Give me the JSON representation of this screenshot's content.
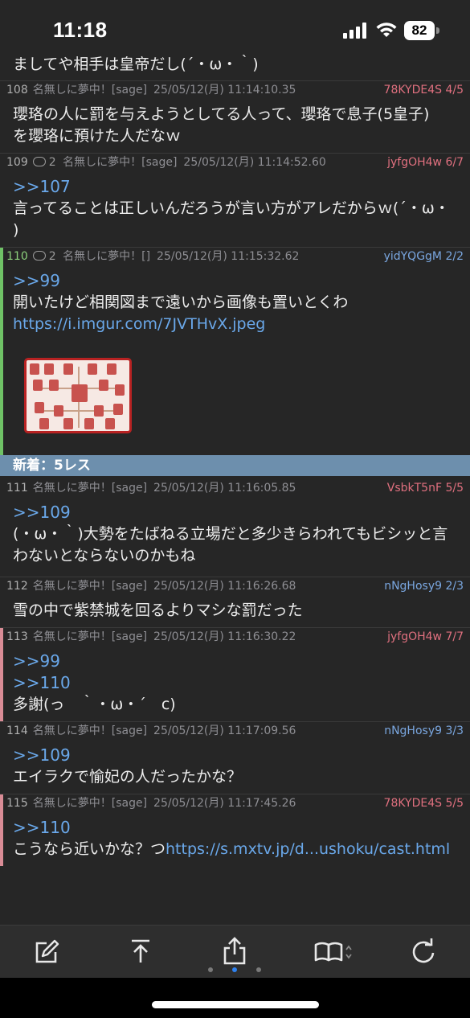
{
  "status": {
    "time": "11:18",
    "battery": "82"
  },
  "prev_line": "ましてや相手は皇帝だし(´・ω・｀)",
  "new_banner": "新着：5レス",
  "posts": [
    {
      "num": "108",
      "name": "名無しに夢中！[sage]",
      "date": "25/05/12(月) 11:14:10.35",
      "id": "78KYDE4S 4/5",
      "lines": [
        "瓔珞の人に罰を与えようとしてる人って、瓔珞で息子(5皇子)",
        "を瓔珞に預けた人だなｗ"
      ]
    },
    {
      "num": "109",
      "replies": "2",
      "name": "名無しに夢中！[sage]",
      "date": "25/05/12(月) 11:14:52.60",
      "id": "jyfgOH4w 6/7",
      "anchor": ">>107",
      "lines": [
        "言ってることは正しいんだろうが言い方がアレだからｗ(´・ω・",
        ")"
      ]
    },
    {
      "num": "110",
      "replies": "2",
      "name": "名無しに夢中！[]",
      "date": "25/05/12(月) 11:15:32.62",
      "id": "yidYQGgM 2/2",
      "anchor": ">>99",
      "lines": [
        "開いたけど相関図まで遠いから画像も置いとくわ"
      ],
      "link": "https://i.imgur.com/7JVTHvX.jpeg"
    },
    {
      "num": "111",
      "name": "名無しに夢中！[sage]",
      "date": "25/05/12(月) 11:16:05.85",
      "id": "VsbkT5nF 5/5",
      "anchor": ">>109",
      "lines": [
        "(・ω・｀)大勢をたばねる立場だと多少きらわれてもビシッと言",
        "わないとならないのかもね"
      ]
    },
    {
      "num": "112",
      "name": "名無しに夢中！[sage]",
      "date": "25/05/12(月) 11:16:26.68",
      "id": "nNgHosy9 2/3",
      "lines": [
        "雪の中で紫禁城を回るよりマシな罰だった"
      ]
    },
    {
      "num": "113",
      "name": "名無しに夢中！[sage]",
      "date": "25/05/12(月) 11:16:30.22",
      "id": "jyfgOH4w 7/7",
      "anchor": ">>99",
      "anchor2": ">>110",
      "lines": [
        "多謝(っ　｀・ω・´　c)"
      ]
    },
    {
      "num": "114",
      "name": "名無しに夢中！[sage]",
      "date": "25/05/12(月) 11:17:09.56",
      "id": "nNgHosy9 3/3",
      "anchor": ">>109",
      "lines": [
        "エイラクで愉妃の人だったかな？"
      ]
    },
    {
      "num": "115",
      "name": "名無しに夢中！[sage]",
      "date": "25/05/12(月) 11:17:45.26",
      "id": "78KYDE4S 5/5",
      "anchor": ">>110",
      "text_prefix": "こうなら近いかな？つ",
      "link": "https://s.mxtv.jp/d...ushoku/cast.html"
    }
  ],
  "toolbar": {
    "icons": [
      "compose-icon",
      "scroll-top-icon",
      "share-icon",
      "bookmarks-icon",
      "reload-icon"
    ]
  },
  "colors": {
    "background": "#262626",
    "anchor": "#6aa8ea",
    "banner": "#6d8fad",
    "id_red": "#e0707f",
    "id_blue": "#7aa7e0"
  }
}
